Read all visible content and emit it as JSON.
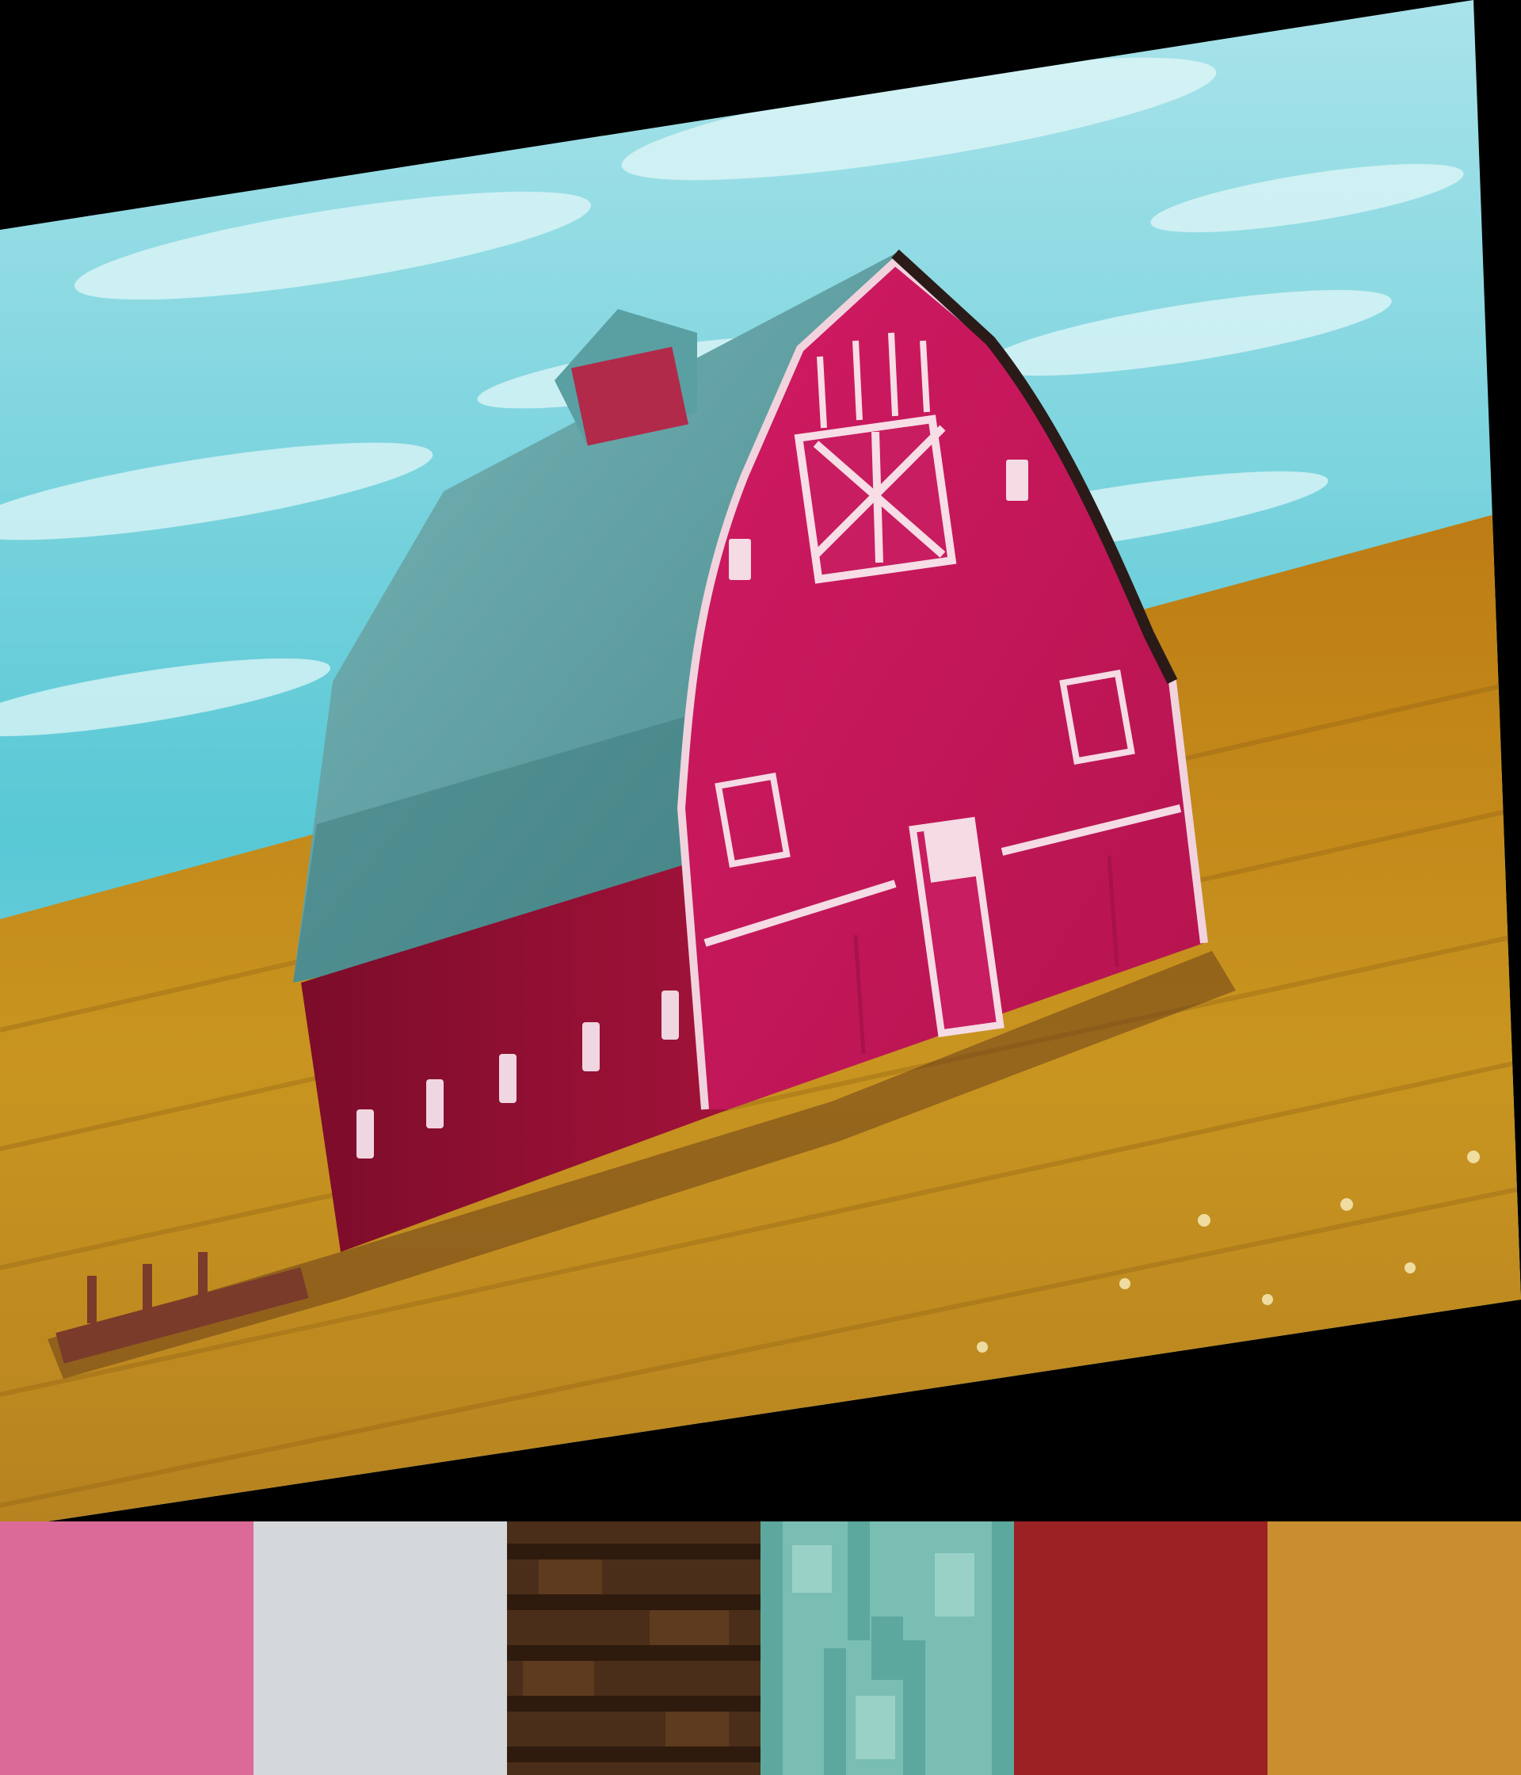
{
  "image": {
    "subject": "barn-in-field",
    "colors": {
      "sky": "#55c7d3",
      "sky_light": "#c9eef0",
      "roof": "#5c9ea0",
      "roof_dark": "#3f7d80",
      "barn_front": "#c61a5c",
      "barn_side": "#8f0f2f",
      "trim": "#f3d9e2",
      "field": "#c88a1a",
      "field_dark": "#936217",
      "border": "#000000"
    }
  },
  "palette": [
    {
      "name": "pink",
      "color": "#db6a98"
    },
    {
      "name": "light-gray",
      "color": "#d4d8db"
    },
    {
      "name": "dark-brown",
      "color": "#4a2e19"
    },
    {
      "name": "aqua",
      "color": "#79bdb3"
    },
    {
      "name": "crimson",
      "color": "#9b2125"
    },
    {
      "name": "golden-yellow",
      "color": "#c88e2f"
    }
  ]
}
